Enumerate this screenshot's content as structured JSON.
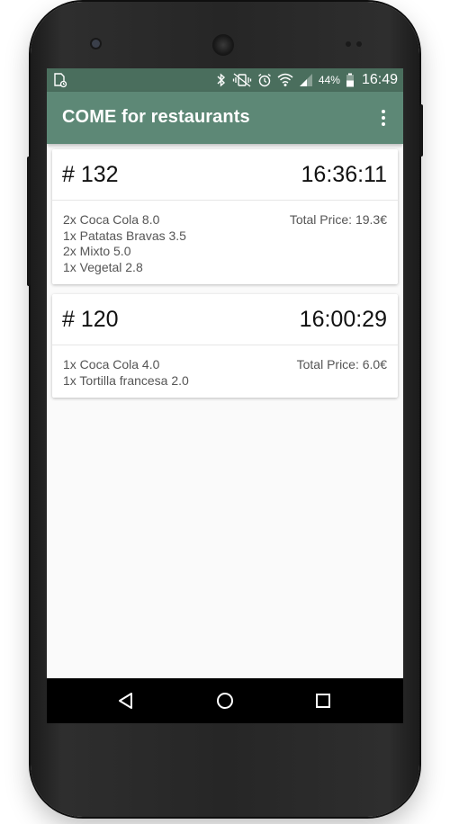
{
  "status_bar": {
    "battery_percent": "44%",
    "time": "16:49",
    "icons": [
      "sim-card-icon",
      "bluetooth-icon",
      "vibrate-icon",
      "alarm-icon",
      "wifi-icon",
      "cell-signal-icon",
      "battery-icon"
    ]
  },
  "app_bar": {
    "title": "COME for restaurants",
    "menu_icon": "overflow-menu-icon"
  },
  "orders": [
    {
      "number": "# 132",
      "time": "16:36:11",
      "items": [
        "2x Coca Cola 8.0",
        "1x Patatas Bravas 3.5",
        "2x Mixto 5.0",
        "1x Vegetal 2.8"
      ],
      "total": "Total Price: 19.3€"
    },
    {
      "number": "# 120",
      "time": "16:00:29",
      "items": [
        "1x Coca Cola 4.0",
        "1x Tortilla francesa 2.0"
      ],
      "total": "Total Price: 6.0€"
    }
  ],
  "nav_bar": {
    "icons": [
      "back-icon",
      "home-icon",
      "recents-icon"
    ]
  },
  "colors": {
    "status_bar": "#4a6e5d",
    "app_bar": "#5d8876",
    "background": "#fafafa"
  }
}
